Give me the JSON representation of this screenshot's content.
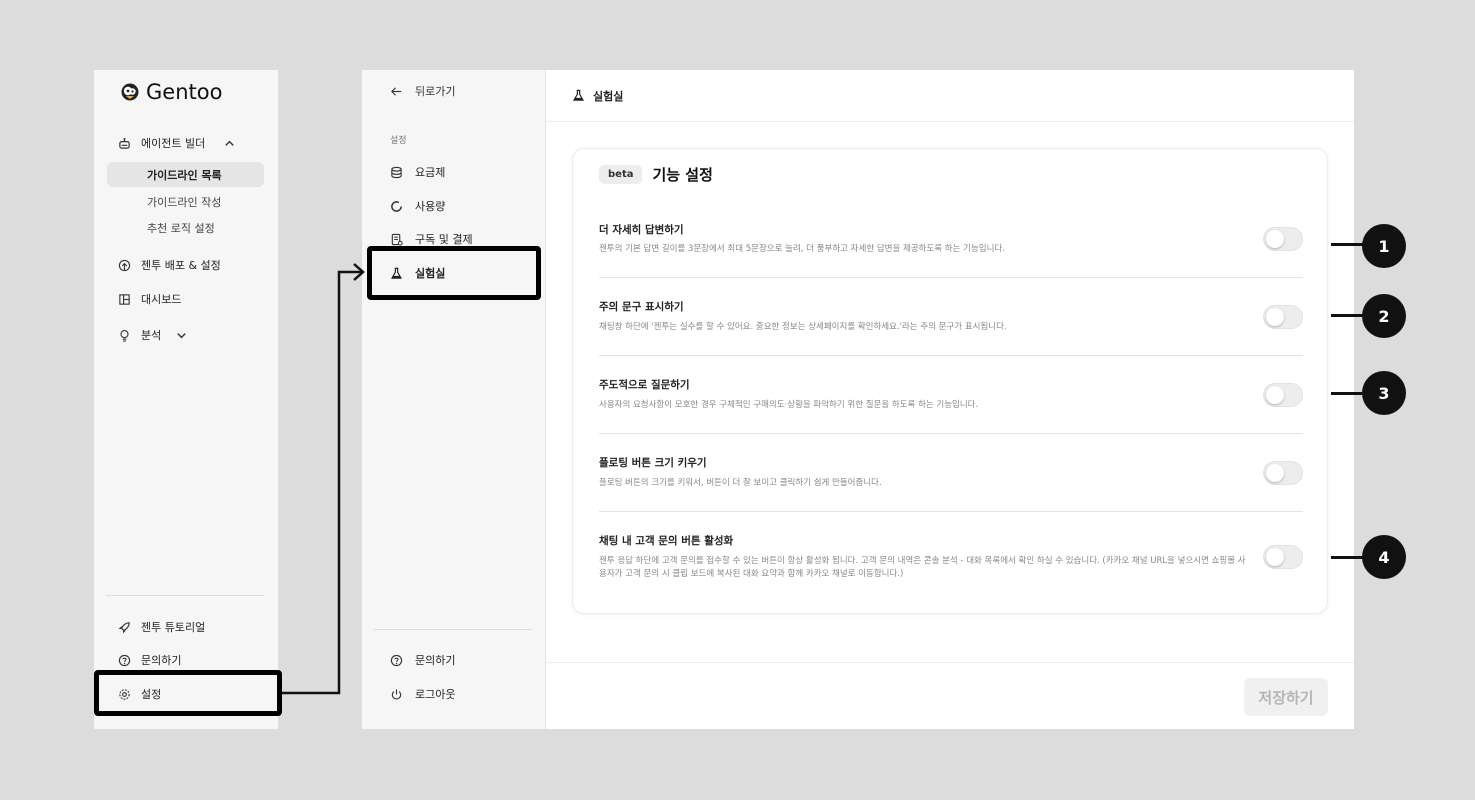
{
  "sidebar": {
    "brand": "Gentoo",
    "agent_builder": "에이전트 빌더",
    "guideline_list": "가이드라인 목록",
    "guideline_write": "가이드라인 작성",
    "recommend_logic": "추천 로직 설정",
    "deploy": "젠투 배포 & 설정",
    "dashboard": "대시보드",
    "analysis": "분석",
    "tutorial": "젠투 튜토리얼",
    "contact": "문의하기",
    "settings": "설정"
  },
  "settings_nav": {
    "back": "뒤로가기",
    "section_label": "설정",
    "plan": "요금제",
    "usage": "사용량",
    "subscription": "구독 및 결제",
    "lab": "실험실",
    "contact": "문의하기",
    "logout": "로그아웃"
  },
  "main": {
    "header_title": "실험실",
    "badge": "beta",
    "card_title": "기능 설정",
    "features": [
      {
        "title": "더 자세히 답변하기",
        "desc": "젠투의 기본 답변 길이를 3문장에서 최대 5문장으로 늘려, 더 풍부하고 자세한 답변을 제공하도록 하는 기능입니다.",
        "enabled": false
      },
      {
        "title": "주의 문구 표시하기",
        "desc": "채팅창 하단에 '젠투는 실수를 할 수 있어요. 중요한 정보는 상세페이지를 확인하세요.'라는 주의 문구가 표시됩니다.",
        "enabled": false
      },
      {
        "title": "주도적으로 질문하기",
        "desc": "사용자의 요청사항이 모호한 경우 구체적인 구매의도·상황을 파악하기 위한 질문을 하도록 하는 기능입니다.",
        "enabled": false
      },
      {
        "title": "플로팅 버튼 크기 키우기",
        "desc": "플로팅 버튼의 크기를 키워서, 버튼이 더 잘 보이고 클릭하기 쉽게 만들어줍니다.",
        "enabled": false
      },
      {
        "title": "채팅 내 고객 문의 버튼 활성화",
        "desc": "젠투 응답 하단에 고객 문의를 접수할 수 있는 버튼이 항상 활성화 됩니다. 고객 문의 내역은 콘솔 분석 - 대화 목록에서 확인 하실 수 있습니다. (카카오 채널 URL을 넣으시면 쇼핑몰 사용자가 고객 문의 시 클립 보드에 복사된 대화 요약과 함께 카카오 채널로 이동합니다.)",
        "enabled": false
      }
    ],
    "save": "저장하기"
  },
  "annotations": {
    "labels": [
      "1",
      "2",
      "3",
      "4"
    ]
  }
}
